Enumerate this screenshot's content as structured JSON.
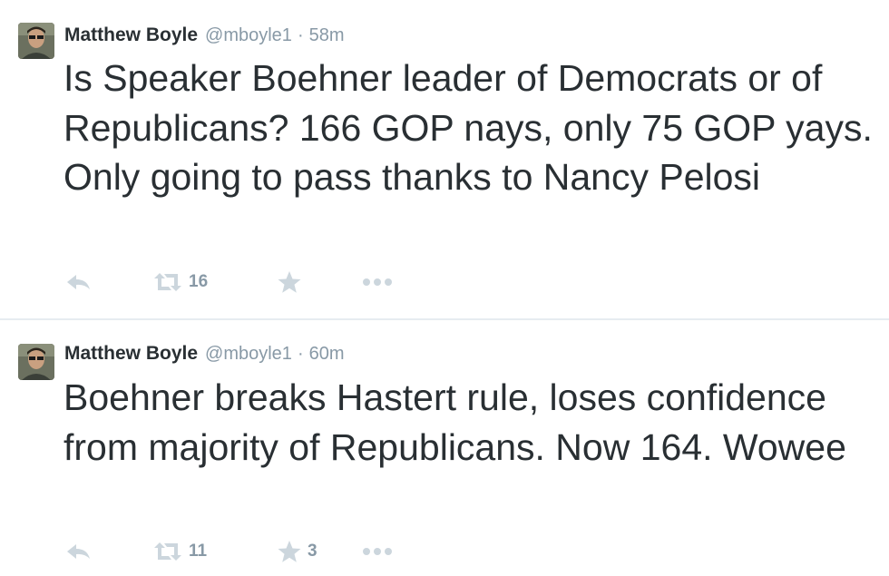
{
  "tweets": [
    {
      "name": "Matthew Boyle",
      "handle": "@mboyle1",
      "separator": "·",
      "time": "58m",
      "text": "Is Speaker Boehner leader of Democrats or of Republicans? 166 GOP nays, only 75 GOP yays. Only going to pass thanks to Nancy Pelosi",
      "retweets": "16",
      "favorites": ""
    },
    {
      "name": "Matthew Boyle",
      "handle": "@mboyle1",
      "separator": "·",
      "time": "60m",
      "text": "Boehner breaks Hastert rule, loses confidence from majority of Republicans. Now 164. Wowee",
      "retweets": "11",
      "favorites": "3"
    }
  ],
  "icons": {
    "reply": "reply-icon",
    "retweet": "retweet-icon",
    "favorite": "star-icon",
    "more": "more-icon"
  },
  "colors": {
    "text": "#292f33",
    "meta": "#8899a6",
    "icon": "#ccd6dd",
    "divider": "#e6ecf0"
  }
}
